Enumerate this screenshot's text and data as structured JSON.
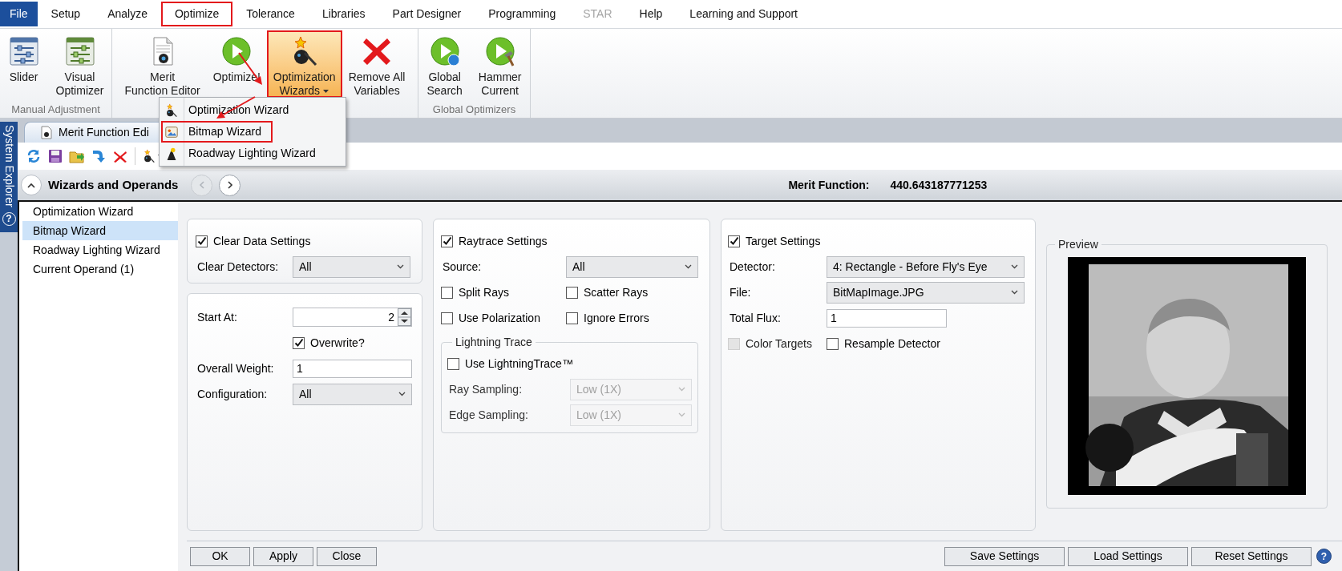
{
  "menu_tabs": [
    {
      "label": "File",
      "kind": "application",
      "highlighted": false,
      "disabled": false
    },
    {
      "label": "Setup",
      "kind": "tab",
      "highlighted": false,
      "disabled": false
    },
    {
      "label": "Analyze",
      "kind": "tab",
      "highlighted": false,
      "disabled": false
    },
    {
      "label": "Optimize",
      "kind": "tab",
      "highlighted": true,
      "disabled": false
    },
    {
      "label": "Tolerance",
      "kind": "tab",
      "highlighted": false,
      "disabled": false
    },
    {
      "label": "Libraries",
      "kind": "tab",
      "highlighted": false,
      "disabled": false
    },
    {
      "label": "Part Designer",
      "kind": "tab",
      "highlighted": false,
      "disabled": false
    },
    {
      "label": "Programming",
      "kind": "tab",
      "highlighted": false,
      "disabled": false
    },
    {
      "label": "STAR",
      "kind": "tab",
      "highlighted": false,
      "disabled": true
    },
    {
      "label": "Help",
      "kind": "tab",
      "highlighted": false,
      "disabled": false
    },
    {
      "label": "Learning and Support",
      "kind": "tab",
      "highlighted": false,
      "disabled": false
    }
  ],
  "ribbon": {
    "groups": [
      {
        "label": "Manual Adjustment",
        "buttons": [
          {
            "lines": [
              "Slider"
            ],
            "selected": false,
            "highlighted": false,
            "dropdown": false
          },
          {
            "lines": [
              "Visual",
              "Optimizer"
            ],
            "selected": false,
            "highlighted": false,
            "dropdown": false
          }
        ]
      },
      {
        "buttons": [
          {
            "lines": [
              "Merit",
              "Function Editor"
            ],
            "selected": false,
            "highlighted": false,
            "dropdown": false
          },
          {
            "lines": [
              "Optimize!"
            ],
            "selected": false,
            "highlighted": false,
            "dropdown": false
          },
          {
            "lines": [
              "Optimization",
              "Wizards"
            ],
            "selected": true,
            "highlighted": true,
            "dropdown": true
          },
          {
            "lines": [
              "Remove All",
              "Variables"
            ],
            "selected": false,
            "highlighted": false,
            "dropdown": false
          }
        ]
      },
      {
        "label": "Global Optimizers",
        "buttons": [
          {
            "lines": [
              "Global",
              "Search"
            ],
            "selected": false,
            "highlighted": false,
            "dropdown": false
          },
          {
            "lines": [
              "Hammer",
              "Current"
            ],
            "selected": false,
            "highlighted": false,
            "dropdown": false
          }
        ]
      }
    ]
  },
  "dropdown_menu": {
    "items": [
      {
        "label": "Optimization Wizard",
        "highlighted": false
      },
      {
        "label": "Bitmap Wizard",
        "highlighted": true
      },
      {
        "label": "Roadway Lighting Wizard",
        "highlighted": false
      }
    ]
  },
  "side_panel": {
    "title": "System Explorer",
    "help_glyph": "?"
  },
  "document_tab": {
    "title": "Merit Function Edi"
  },
  "header": {
    "title": "Wizards and Operands",
    "history_buttons": [
      {
        "disabled": true
      },
      {
        "disabled": false
      }
    ],
    "merit_label": "Merit Function:",
    "merit_value": "440.643187771253"
  },
  "wizard_list": [
    {
      "label": "Optimization Wizard",
      "selected": false
    },
    {
      "label": "Bitmap Wizard",
      "selected": true
    },
    {
      "label": "Roadway Lighting Wizard",
      "selected": false
    },
    {
      "label": "Current Operand (1)",
      "selected": false
    }
  ],
  "panels": [
    {
      "rows": [
        {
          "kind": "checkbox",
          "label": "Clear Data Settings",
          "checked": true,
          "disabled": false
        },
        {
          "kind": "dropdown",
          "label": "Clear Detectors:",
          "value": "All",
          "disabled": false
        }
      ]
    },
    {
      "rows": [
        {
          "kind": "spinner",
          "label": "Start At:",
          "value": "2"
        },
        {
          "kind": "subcheckbox",
          "label": "Overwrite?",
          "checked": true,
          "disabled": false
        },
        {
          "kind": "text",
          "label": "Overall Weight:",
          "value": "1"
        },
        {
          "kind": "dropdown",
          "label": "Configuration:",
          "value": "All",
          "disabled": false
        }
      ]
    },
    {
      "rows": [
        {
          "kind": "checkbox",
          "label": "Raytrace Settings",
          "checked": true,
          "disabled": false
        },
        {
          "kind": "dropdown",
          "label": "Source:",
          "value": "All",
          "disabled": false
        },
        {
          "kind": "pair",
          "items": [
            {
              "label": "Split Rays",
              "checked": false,
              "disabled": false
            },
            {
              "label": "Scatter Rays",
              "checked": false,
              "disabled": false
            }
          ]
        },
        {
          "kind": "pair",
          "items": [
            {
              "label": "Use Polarization",
              "checked": false,
              "disabled": false
            },
            {
              "label": "Ignore Errors",
              "checked": false,
              "disabled": false
            }
          ]
        },
        {
          "kind": "group",
          "title": "Lightning Trace",
          "rows": [
            {
              "kind": "checkbox",
              "label": "Use LightningTrace™",
              "checked": false,
              "disabled": false
            },
            {
              "kind": "dropdown",
              "label": "Ray Sampling:",
              "value": "Low (1X)",
              "disabled": true
            },
            {
              "kind": "dropdown",
              "label": "Edge Sampling:",
              "value": "Low (1X)",
              "disabled": true
            }
          ]
        }
      ]
    },
    {
      "rows": [
        {
          "kind": "checkbox",
          "label": "Target Settings",
          "checked": true,
          "disabled": false
        },
        {
          "kind": "dropdown",
          "label": "Detector:",
          "value": "4: Rectangle - Before Fly's Eye",
          "disabled": false
        },
        {
          "kind": "dropdown",
          "label": "File:",
          "value": "BitMapImage.JPG",
          "disabled": false
        },
        {
          "kind": "text",
          "label": "Total Flux:",
          "value": "1"
        },
        {
          "kind": "pair",
          "items": [
            {
              "label": "Color Targets",
              "checked": false,
              "disabled": true
            },
            {
              "label": "Resample Detector",
              "checked": false,
              "disabled": false
            }
          ]
        }
      ]
    }
  ],
  "preview": {
    "title": "Preview",
    "kind": "picture"
  },
  "buttons_left": [
    "OK",
    "Apply",
    "Close"
  ],
  "buttons_right": [
    "Save Settings",
    "Load Settings",
    "Reset Settings"
  ],
  "help_glyph": "?"
}
